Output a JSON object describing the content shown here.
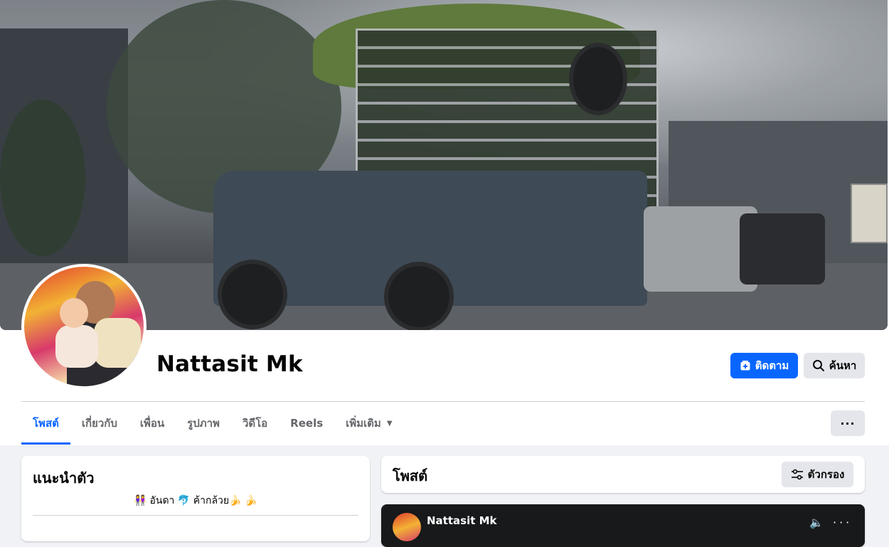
{
  "profile": {
    "name": "Nattasit Mk",
    "follow_label": "ติดตาม",
    "search_label": "ค้นหา"
  },
  "tabs": [
    {
      "label": "โพสต์",
      "active": true
    },
    {
      "label": "เกี่ยวกับ",
      "active": false
    },
    {
      "label": "เพื่อน",
      "active": false
    },
    {
      "label": "รูปภาพ",
      "active": false
    },
    {
      "label": "วิดีโอ",
      "active": false
    },
    {
      "label": "Reels",
      "active": false
    },
    {
      "label": "เพิ่มเติม",
      "active": false
    }
  ],
  "more_button_label": "···",
  "intro": {
    "title": "แนะนำตัว",
    "bio": "👭 อันดา 🐬 ค้ากล้วย🍌 🍌"
  },
  "posts": {
    "title": "โพสต์",
    "filter_label": "ตัวกรอง",
    "first_post": {
      "author": "Nattasit Mk",
      "icons": "🔈 ···"
    }
  },
  "colors": {
    "accent": "#0866ff",
    "background": "#f0f2f5",
    "button_gray": "#e4e6eb"
  }
}
